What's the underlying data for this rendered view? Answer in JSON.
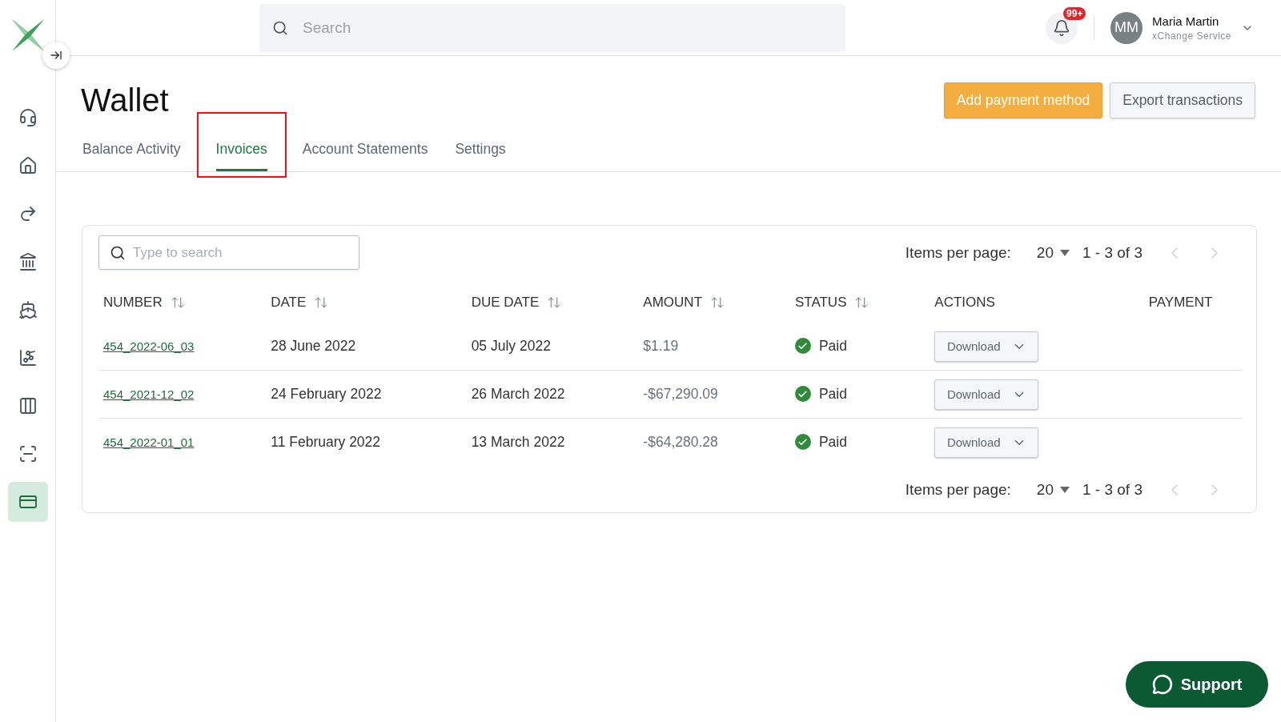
{
  "sidebar": {
    "items": [
      {
        "selected": false
      },
      {
        "selected": false
      },
      {
        "selected": false
      },
      {
        "selected": false
      },
      {
        "selected": false
      },
      {
        "selected": false
      },
      {
        "selected": false
      },
      {
        "selected": false
      },
      {
        "selected": true
      }
    ]
  },
  "header": {
    "search": {
      "placeholder": "Search"
    },
    "notifications": {
      "badge": "99+"
    },
    "user": {
      "initials": "MM",
      "name": "Maria Martin",
      "company": "xChange Service"
    }
  },
  "page": {
    "title": "Wallet",
    "actions": [
      {
        "label": "Add payment method",
        "kind": "primary"
      },
      {
        "label": "Export transactions",
        "kind": "secondary"
      }
    ]
  },
  "tabs": [
    {
      "label": "Balance Activity",
      "selected": false,
      "highlighted": false
    },
    {
      "label": "Invoices",
      "selected": true,
      "highlighted": true
    },
    {
      "label": "Account Statements",
      "selected": false,
      "highlighted": false
    },
    {
      "label": "Settings",
      "selected": false,
      "highlighted": false
    }
  ],
  "table": {
    "search": {
      "placeholder": "Type to search"
    },
    "pagination_top": {
      "label": "Items per page:",
      "per_page": "20",
      "range": "1 - 3 of 3",
      "prev_disabled": true,
      "next_disabled": true
    },
    "columns": [
      {
        "label": "NUMBER",
        "sortable": true
      },
      {
        "label": "DATE",
        "sortable": true
      },
      {
        "label": "DUE DATE",
        "sortable": true
      },
      {
        "label": "AMOUNT",
        "sortable": true
      },
      {
        "label": "STATUS",
        "sortable": true
      },
      {
        "label": "ACTIONS",
        "sortable": false
      },
      {
        "label": "PAYMENT",
        "sortable": false
      }
    ],
    "rows": [
      {
        "number": "454_2022-06_03",
        "date": "28 June 2022",
        "due_date": "05 July 2022",
        "amount": "$1.19",
        "status": {
          "kind": "paid",
          "label": "Paid"
        },
        "action": "Download"
      },
      {
        "number": "454_2021-12_02",
        "date": "24 February 2022",
        "due_date": "26 March 2022",
        "amount": "-$67,290.09",
        "status": {
          "kind": "paid",
          "label": "Paid"
        },
        "action": "Download"
      },
      {
        "number": "454_2022-01_01",
        "date": "11 February 2022",
        "due_date": "13 March 2022",
        "amount": "-$64,280.28",
        "status": {
          "kind": "paid",
          "label": "Paid"
        },
        "action": "Download"
      }
    ],
    "pagination_bottom": {
      "label": "Items per page:",
      "per_page": "20",
      "range": "1 - 3 of 3",
      "prev_disabled": true,
      "next_disabled": true
    }
  },
  "support": {
    "label": "Support"
  }
}
